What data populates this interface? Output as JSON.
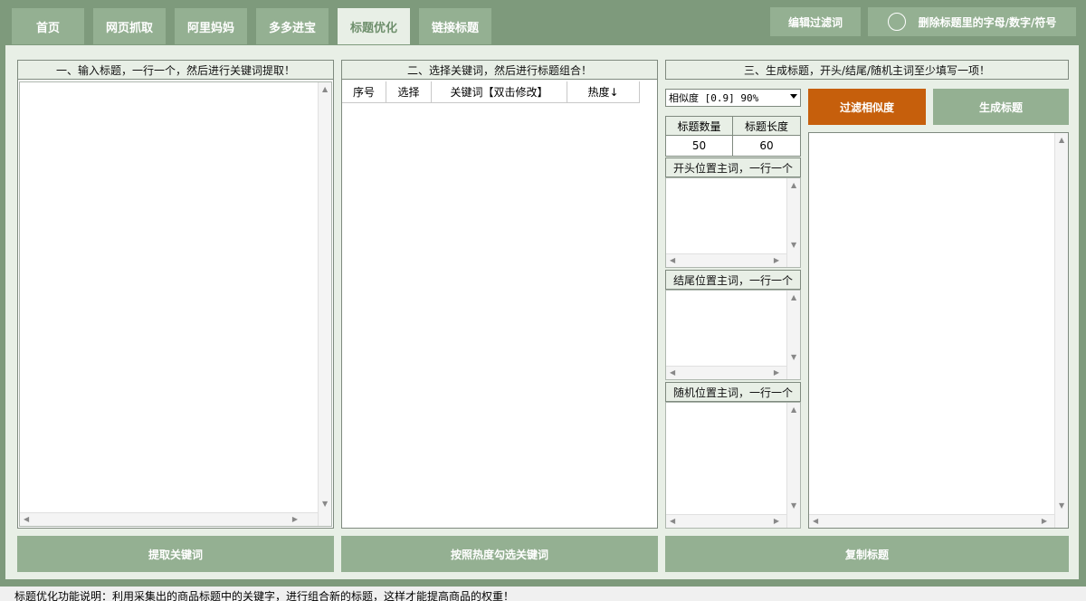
{
  "tabs": [
    {
      "label": "首页",
      "active": false
    },
    {
      "label": "网页抓取",
      "active": false
    },
    {
      "label": "阿里妈妈",
      "active": false
    },
    {
      "label": "多多进宝",
      "active": false
    },
    {
      "label": "标题优化",
      "active": true
    },
    {
      "label": "链接标题",
      "active": false
    }
  ],
  "toolbar": {
    "edit_filter_label": "编辑过滤词",
    "remove_chars_label": "删除标题里的字母/数字/符号"
  },
  "panel1": {
    "header": "一、输入标题，一行一个，然后进行关键词提取！",
    "button": "提取关键词"
  },
  "panel2": {
    "header": "二、选择关键词，然后进行标题组合！",
    "columns": [
      "序号",
      "选择",
      "关键词【双击修改】",
      "热度↓"
    ],
    "button": "按照热度勾选关键词"
  },
  "panel3": {
    "header": "三、生成标题，开头/结尾/随机主词至少填写一项！",
    "similarity_select": "相似度 [0.9] 90%",
    "filter_button": "过滤相似度",
    "generate_button": "生成标题",
    "count_label": "标题数量",
    "length_label": "标题长度",
    "count_value": "50",
    "length_value": "60",
    "start_label": "开头位置主词，一行一个",
    "end_label": "结尾位置主词，一行一个",
    "random_label": "随机位置主词，一行一个",
    "copy_button": "复制标题"
  },
  "footer": {
    "text": "标题优化功能说明：利用采集出的商品标题中的关键字，进行组合新的标题，这样才能提高商品的权重！"
  },
  "colors": {
    "background": "#7e9a7c",
    "tab": "#94b092",
    "tab_active_bg": "#e8efe6",
    "accent_orange": "#c65f0c"
  }
}
